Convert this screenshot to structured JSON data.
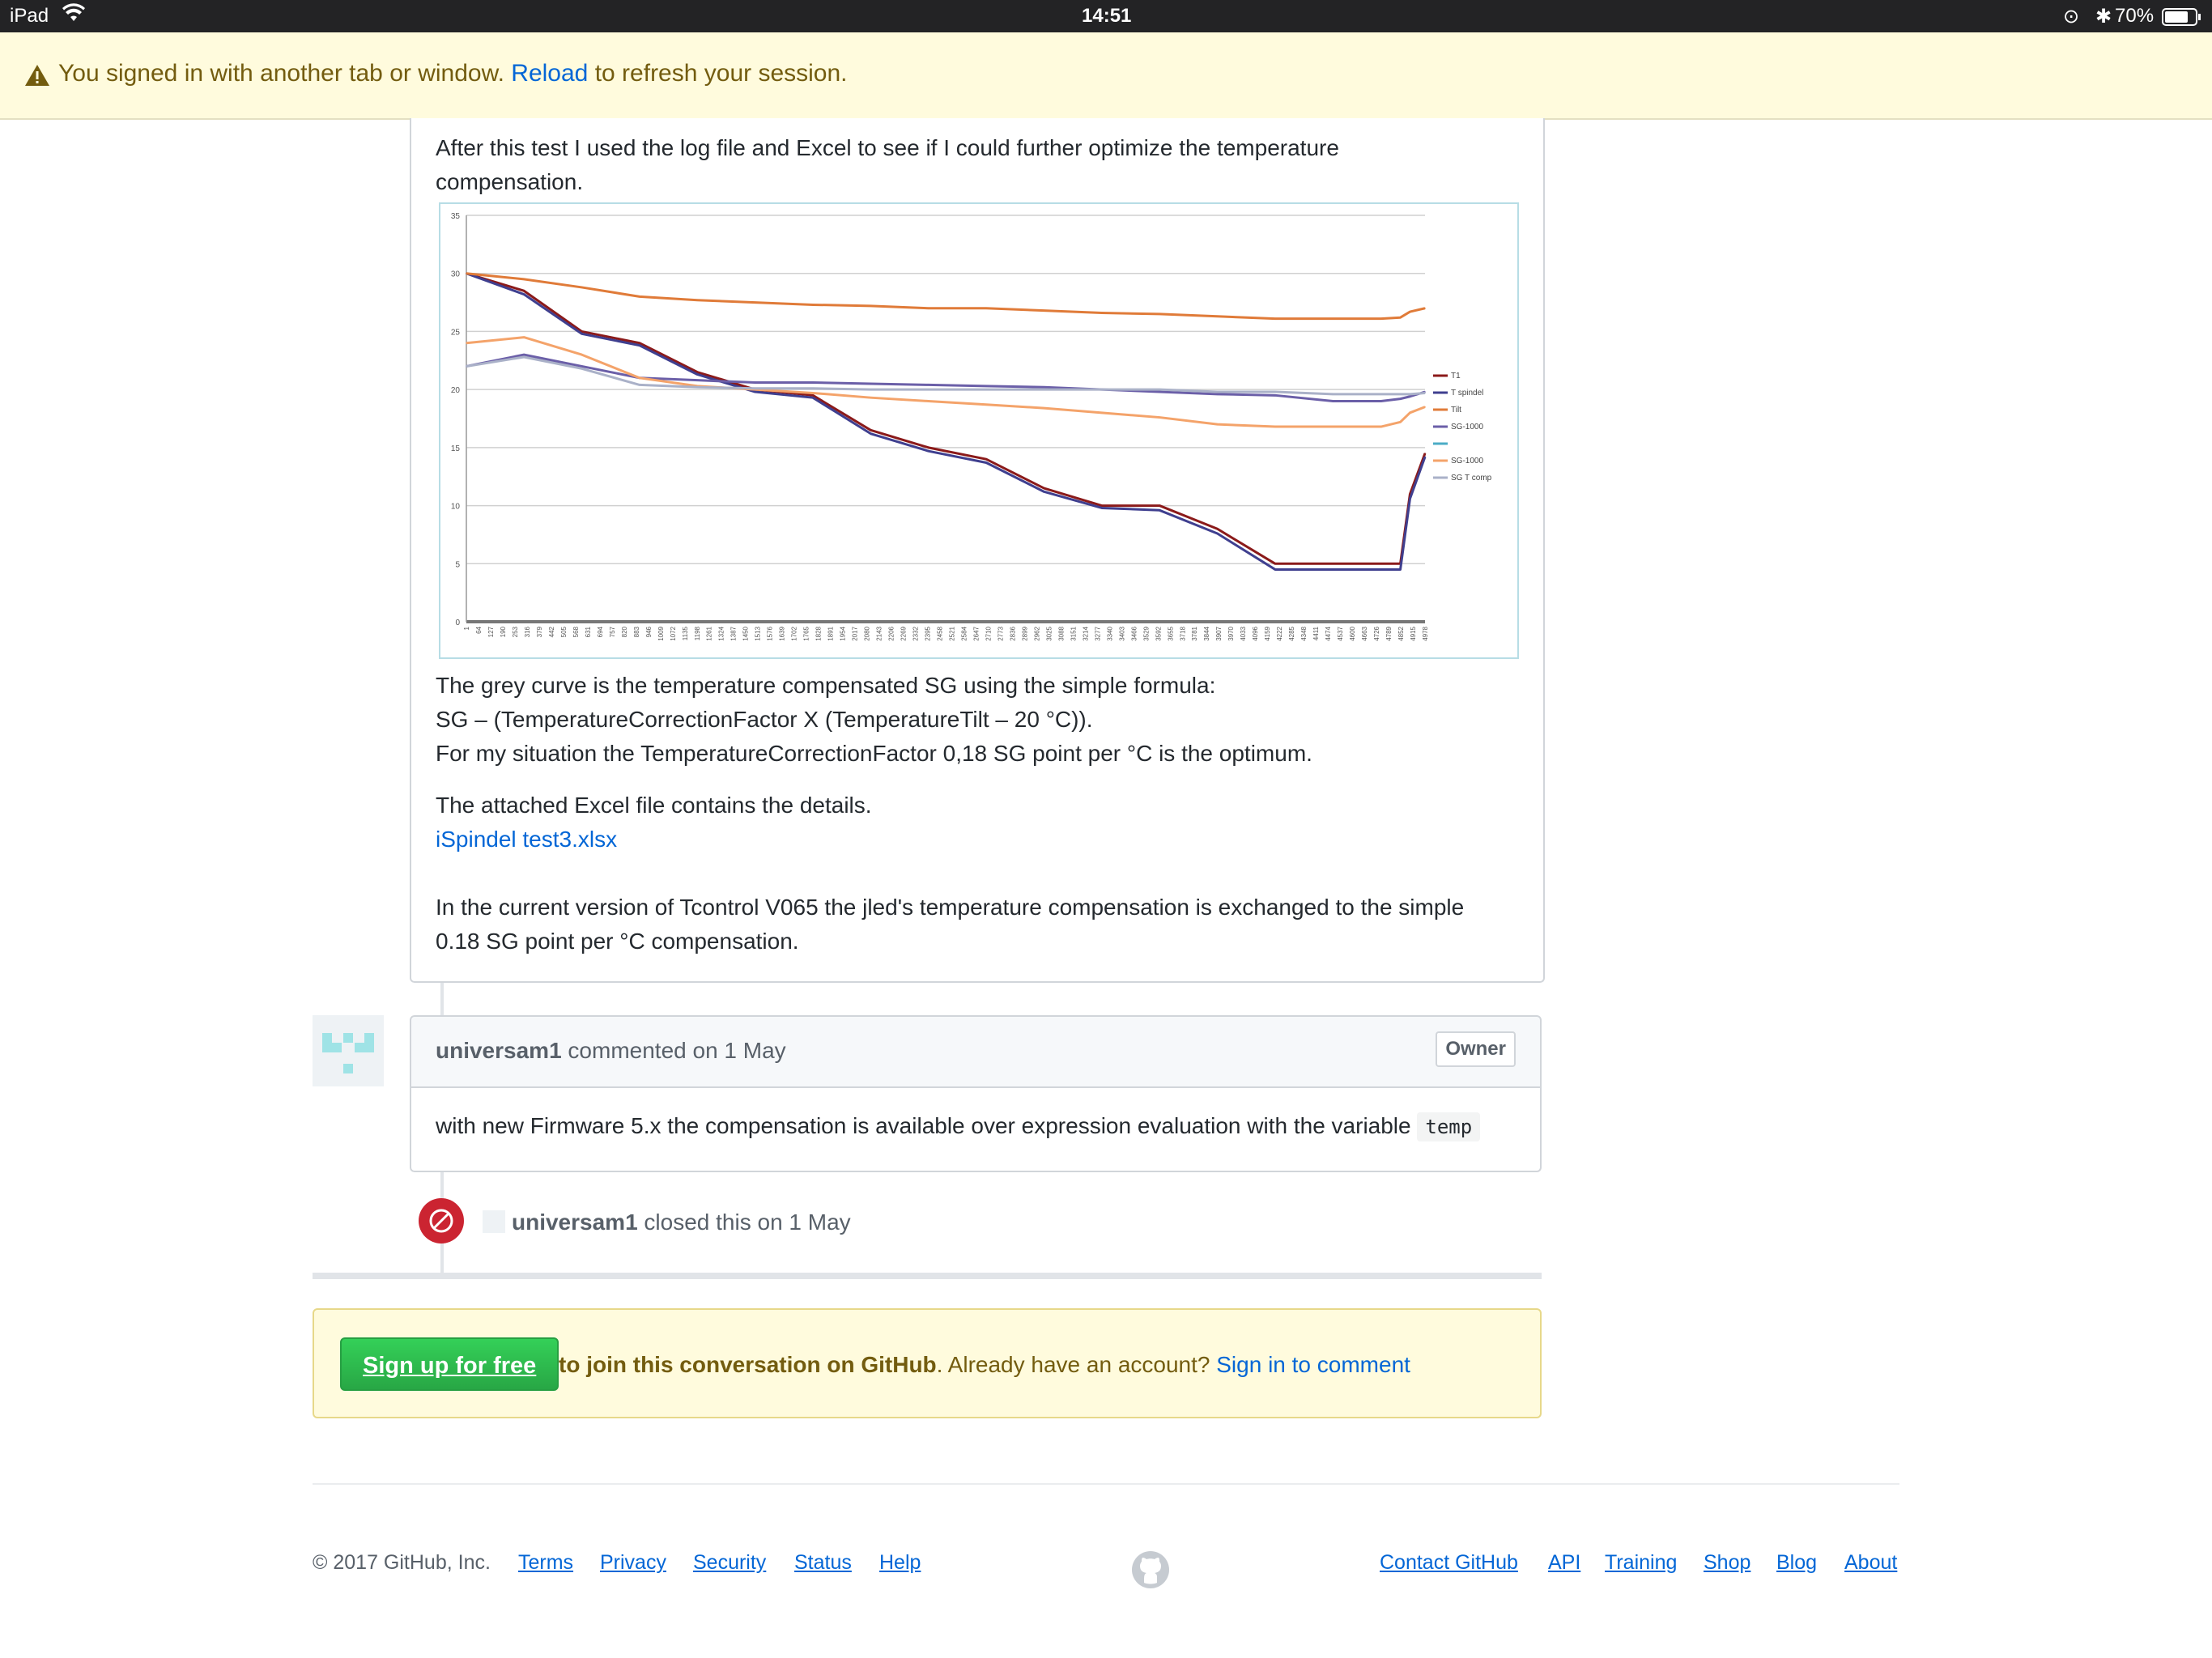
{
  "status_bar": {
    "device": "iPad",
    "time": "14:51",
    "battery": "70%"
  },
  "flash": {
    "message_before": "You signed in with another tab or window.",
    "reload_link": "Reload",
    "message_after": "to refresh your session."
  },
  "comment1": {
    "intro_line1": "After this test I used the log file and Excel to see if I could further optimize the temperature",
    "intro_line2": "compensation.",
    "para1_line1": "The grey curve is the temperature compensated SG using the simple formula:",
    "para1_line2": "SG – (TemperatureCorrectionFactor X (TemperatureTilt – 20 °C)).",
    "para1_line3": "For my situation the TemperatureCorrectionFactor 0,18 SG point per °C is the optimum.",
    "para2_line1": "The attached Excel file contains the details.",
    "attachment_link": "iSpindel test3.xlsx",
    "para3_line1": "In the current version of Tcontrol V065 the jled's temperature compensation is exchanged to the simple",
    "para3_line2": "0.18 SG point per °C compensation."
  },
  "chart_data": {
    "type": "line",
    "title": "",
    "xlabel": "",
    "ylabel": "",
    "ylim": [
      0,
      35
    ],
    "yticks": [
      "0",
      "5",
      "10",
      "15",
      "20",
      "25",
      "30",
      "35"
    ],
    "x_ticks": [
      "1",
      "64",
      "127",
      "190",
      "253",
      "316",
      "379",
      "442",
      "505",
      "568",
      "631",
      "694",
      "757",
      "820",
      "883",
      "946",
      "1009",
      "1072",
      "1135",
      "1198",
      "1261",
      "1324",
      "1387",
      "1450",
      "1513",
      "1576",
      "1639",
      "1702",
      "1765",
      "1828",
      "1891",
      "1954",
      "2017",
      "2080",
      "2143",
      "2206",
      "2269",
      "2332",
      "2395",
      "2458",
      "2521",
      "2584",
      "2647",
      "2710",
      "2773",
      "2836",
      "2899",
      "2962",
      "3025",
      "3088",
      "3151",
      "3214",
      "3277",
      "3340",
      "3403",
      "3466",
      "3529",
      "3592",
      "3655",
      "3718",
      "3781",
      "3844",
      "3907",
      "3970",
      "4033",
      "4096",
      "4159",
      "4222",
      "4285",
      "4348",
      "4411",
      "4474",
      "4537",
      "4600",
      "4663",
      "4726",
      "4789",
      "4852",
      "4915",
      "4978"
    ],
    "grid": true,
    "legend_position": "right",
    "x": [
      1,
      300,
      600,
      900,
      1200,
      1500,
      1800,
      2100,
      2400,
      2700,
      3000,
      3300,
      3600,
      3900,
      4200,
      4500,
      4750,
      4850,
      4900,
      4978
    ],
    "series": [
      {
        "name": "T1",
        "color": "#8b1a1a",
        "values": [
          30,
          28.5,
          25,
          24,
          21.5,
          20,
          19.5,
          16.5,
          15,
          14,
          11.5,
          10,
          10,
          8,
          5,
          5,
          5,
          5,
          11,
          14.5
        ]
      },
      {
        "name": "T spindel",
        "color": "#3f3f8f",
        "values": [
          30,
          28.2,
          24.8,
          23.8,
          21.3,
          19.8,
          19.3,
          16.2,
          14.7,
          13.7,
          11.2,
          9.8,
          9.6,
          7.6,
          4.5,
          4.5,
          4.5,
          4.5,
          10.6,
          14.2
        ]
      },
      {
        "name": "Tilt",
        "color": "#e07b39",
        "values": [
          30,
          29.5,
          28.8,
          28,
          27.7,
          27.5,
          27.3,
          27.2,
          27,
          27,
          26.8,
          26.6,
          26.5,
          26.3,
          26.1,
          26.1,
          26.1,
          26.2,
          26.7,
          27
        ]
      },
      {
        "name": "SG-1000",
        "color": "#6b5fa8",
        "values": [
          22,
          23,
          22,
          21,
          20.8,
          20.6,
          20.6,
          20.5,
          20.4,
          20.3,
          20.2,
          20,
          19.8,
          19.6,
          19.5,
          19,
          19,
          19.2,
          19.4,
          19.8
        ]
      },
      {
        "name": "",
        "color": "#4bacc6",
        "values": []
      },
      {
        "name": "SG-1000",
        "color": "#f4a36a",
        "values": [
          24,
          24.5,
          23,
          21,
          20.3,
          20,
          19.7,
          19.3,
          19,
          18.7,
          18.4,
          18,
          17.6,
          17,
          16.8,
          16.8,
          16.8,
          17.2,
          18,
          18.5
        ]
      },
      {
        "name": "SG T comp",
        "color": "#aab1c8",
        "values": [
          22,
          22.8,
          21.8,
          20.4,
          20.2,
          20.1,
          20.1,
          20,
          20,
          20,
          20,
          20,
          20,
          19.8,
          19.8,
          19.6,
          19.6,
          19.6,
          19.6,
          19.7
        ]
      }
    ]
  },
  "comment2": {
    "author": "universam1",
    "meta": "commented on 1 May",
    "badge": "Owner",
    "body_text": "with new Firmware 5.x the compensation is available over expression evaluation with the variable",
    "code": "temp"
  },
  "closed_event": {
    "author": "universam1",
    "action": "closed this on 1 May"
  },
  "signup": {
    "button": "Sign up for free",
    "bold_text": "to join this conversation on GitHub",
    "plain_text": ". Already have an account?",
    "signin_link": "Sign in to comment"
  },
  "footer": {
    "copyright": "© 2017 GitHub, Inc.",
    "left_links": [
      "Terms",
      "Privacy",
      "Security",
      "Status",
      "Help"
    ],
    "right_links": [
      "Contact GitHub",
      "API",
      "Training",
      "Shop",
      "Blog",
      "About"
    ]
  },
  "colors": {
    "link": "#0366d6",
    "flash_bg": "#fffbdd",
    "closed_red": "#cb2431",
    "signup_green": "#28a745"
  }
}
